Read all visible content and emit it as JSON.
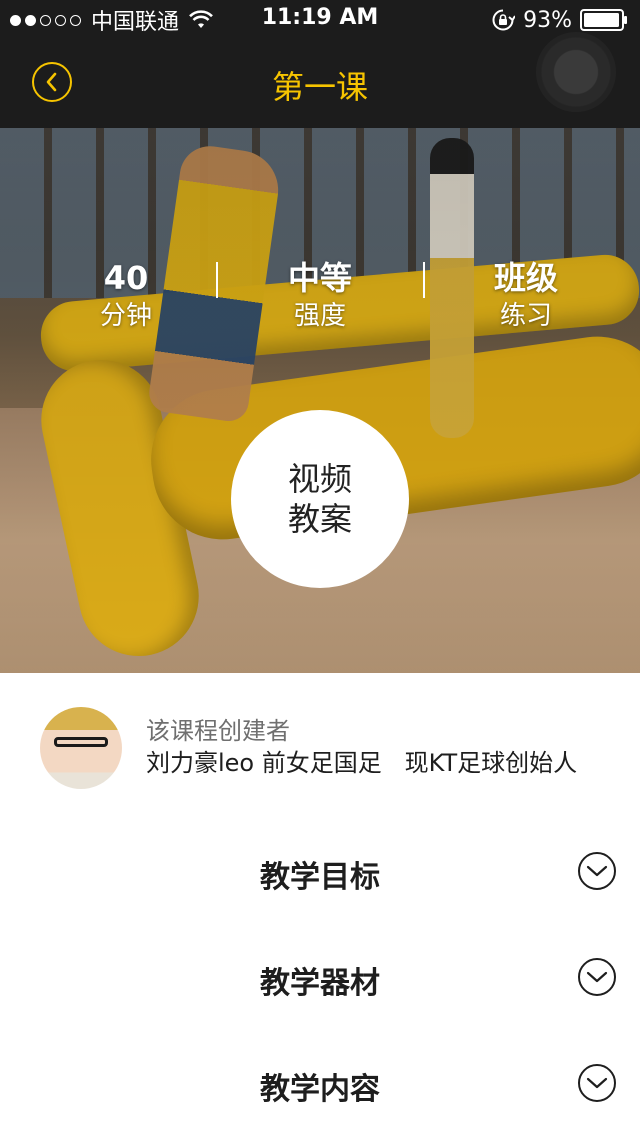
{
  "status_bar": {
    "carrier": "中国联通",
    "time": "11:19 AM",
    "battery_percent": "93%",
    "signal_bars": 2,
    "signal_total": 5
  },
  "nav": {
    "title": "第一课",
    "back_icon": "chevron-left-icon",
    "accent_color": "#f6c400"
  },
  "stats": [
    {
      "value": "40",
      "label": "分钟"
    },
    {
      "value": "中等",
      "label": "强度"
    },
    {
      "value": "班级",
      "label": "练习"
    }
  ],
  "video_plan": {
    "line1": "视频",
    "line2": "教案"
  },
  "creator": {
    "label": "该课程创建者",
    "description": "刘力豪leo 前女足国足   现KT足球创始人"
  },
  "sections": [
    {
      "title": "教学目标",
      "icon": "chevron-down-icon"
    },
    {
      "title": "教学器材",
      "icon": "chevron-down-icon"
    },
    {
      "title": "教学内容",
      "icon": "chevron-down-icon"
    }
  ]
}
